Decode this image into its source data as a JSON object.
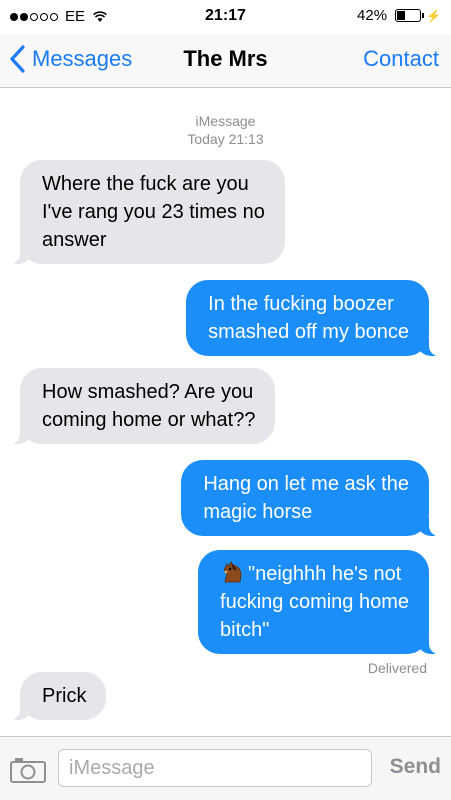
{
  "status_bar": {
    "signal_filled": 2,
    "signal_total": 5,
    "carrier": "EE",
    "time": "21:17",
    "battery_text": "42%",
    "battery_level": 0.42
  },
  "nav": {
    "back_label": "Messages",
    "title": "The Mrs",
    "contact_label": "Contact"
  },
  "thread": {
    "service": "iMessage",
    "timestamp": "Today 21:13"
  },
  "messages": [
    {
      "direction": "incoming",
      "text": "Where the fuck are you\nI've rang you 23 times no\nanswer"
    },
    {
      "direction": "outgoing",
      "text": "In the fucking boozer\nsmashed off my bonce"
    },
    {
      "direction": "incoming",
      "text": "How smashed? Are you\ncoming home or what??"
    },
    {
      "direction": "outgoing",
      "text": "Hang on let me ask the\nmagic horse"
    },
    {
      "direction": "outgoing",
      "icon": "horse-face-emoji",
      "text": "\"neighhh he's not\nfucking coming home\nbitch\""
    },
    {
      "direction": "incoming",
      "text": "Prick"
    }
  ],
  "delivered_label": "Delivered",
  "input_bar": {
    "placeholder": "iMessage",
    "send_label": "Send",
    "camera_icon": "camera-icon"
  },
  "colors": {
    "accent": "#1a7bf5",
    "outgoing_bubble": "#1c8ef9",
    "incoming_bubble": "#e5e5ea",
    "meta_text": "#8e8e93"
  }
}
